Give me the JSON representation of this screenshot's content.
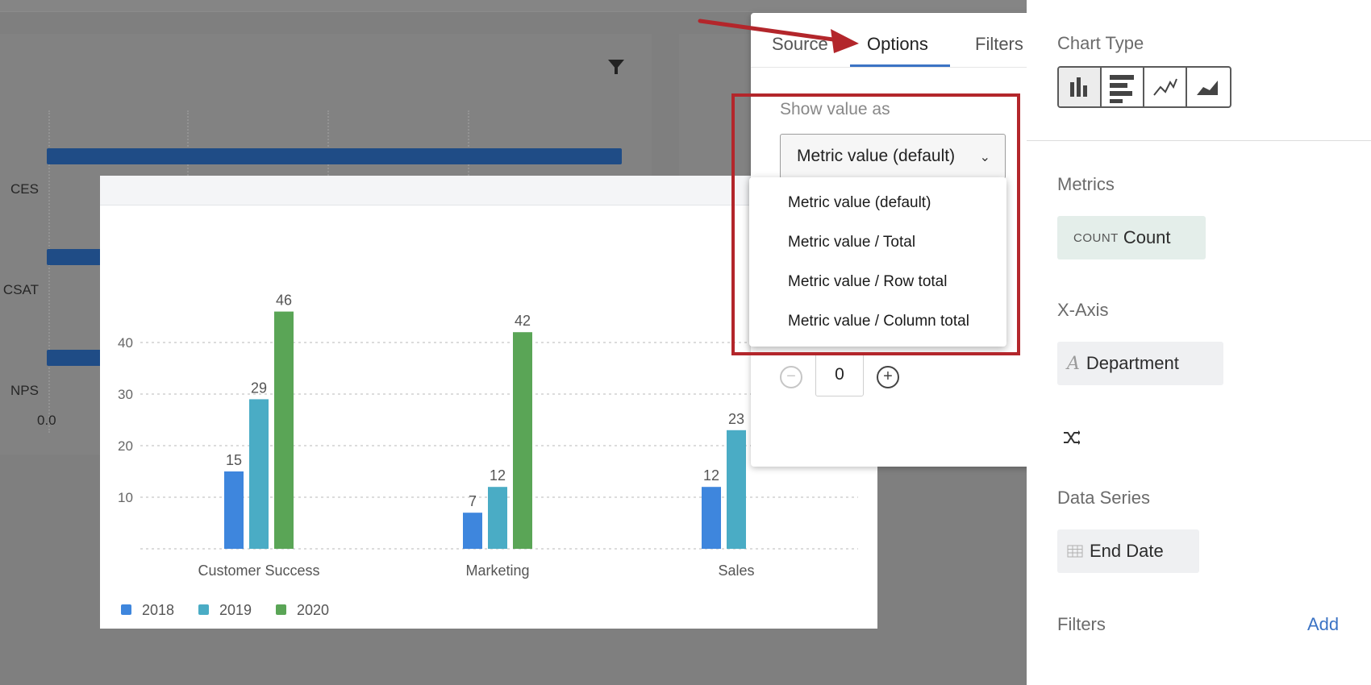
{
  "background_chart": {
    "rows": [
      "CES",
      "CSAT",
      "NPS"
    ],
    "values": [
      1.0,
      null,
      null
    ],
    "x_tick": "0.0"
  },
  "chart_data": {
    "type": "bar",
    "categories": [
      "Customer Success",
      "Marketing",
      "Sales"
    ],
    "series": [
      {
        "name": "2018",
        "values": [
          15,
          7,
          12
        ],
        "color": "#3e86dd"
      },
      {
        "name": "2019",
        "values": [
          29,
          12,
          23
        ],
        "color": "#4aacc5"
      },
      {
        "name": "2020",
        "values": [
          46,
          42,
          null
        ],
        "color": "#5aa556"
      }
    ],
    "yticks": [
      "10",
      "20",
      "30",
      "40"
    ],
    "ylim": [
      0,
      50
    ],
    "grid": true,
    "legend": "bottom-left"
  },
  "options_panel": {
    "tabs": [
      "Source",
      "Options",
      "Filters"
    ],
    "active_tab": "Options",
    "show_value_label": "Show value as",
    "selected_value": "Metric value (default)",
    "menu_options": [
      "Metric value (default)",
      "Metric value / Total",
      "Metric value / Row total",
      "Metric value / Column total"
    ],
    "stepper_value": "0",
    "highlight_color": "#b3262b"
  },
  "sidebar": {
    "chart_type_label": "Chart Type",
    "chart_type_icons": [
      "bar-chart-icon",
      "horizontal-bar-icon",
      "line-chart-icon",
      "area-chart-icon"
    ],
    "metrics_label": "Metrics",
    "metric_prefix": "COUNT",
    "metric_name": "Count",
    "xaxis_label": "X-Axis",
    "xaxis_field": "Department",
    "data_series_label": "Data Series",
    "data_series_field": "End Date",
    "filters_label": "Filters",
    "filters_add": "Add",
    "accent_color": "#3b73c4"
  }
}
